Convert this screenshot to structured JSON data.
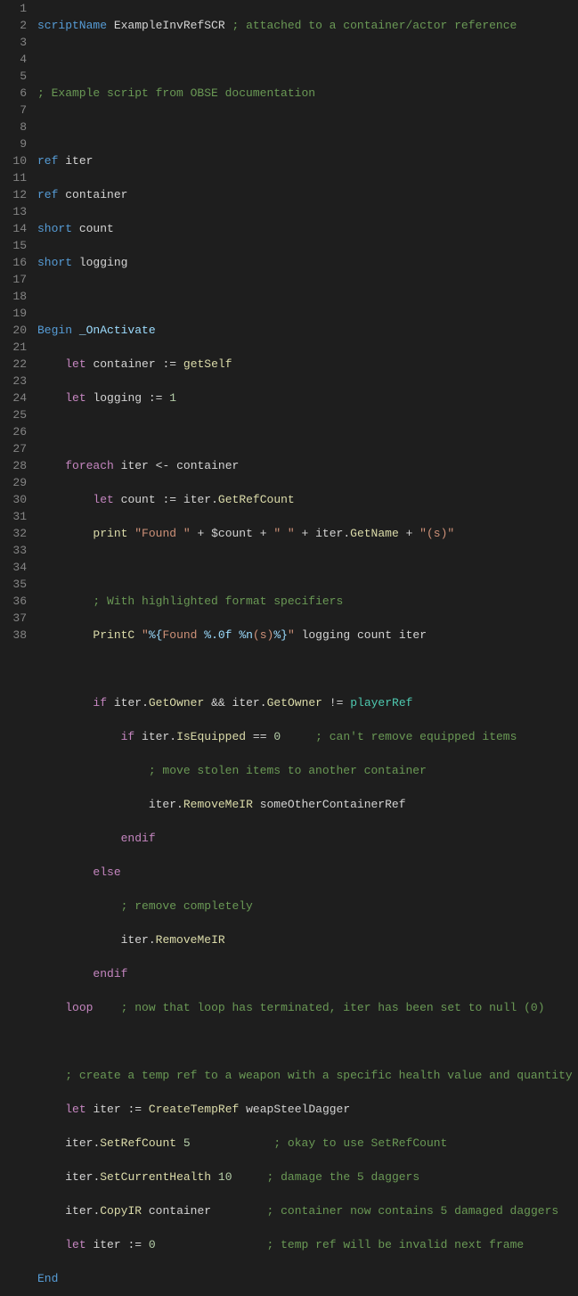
{
  "gutter": {
    "start": 1,
    "end": 38
  },
  "code": {
    "l1": {
      "kw": "scriptName",
      "name": "ExampleInvRefSCR",
      "com": "; attached to a container/actor reference"
    },
    "l3": {
      "com": "; Example script from OBSE documentation"
    },
    "l5": {
      "kw": "ref",
      "name": "iter"
    },
    "l6": {
      "kw": "ref",
      "name": "container"
    },
    "l7": {
      "kw": "short",
      "name": "count"
    },
    "l8": {
      "kw": "short",
      "name": "logging"
    },
    "l10": {
      "kw": "Begin",
      "name": "_OnActivate"
    },
    "l11": {
      "kw": "let",
      "name": "container",
      "op": ":=",
      "fn": "getSelf"
    },
    "l12": {
      "kw": "let",
      "name": "logging",
      "op": ":=",
      "num": "1"
    },
    "l14": {
      "kw": "foreach",
      "name": "iter",
      "op": "<-",
      "name2": "container"
    },
    "l15": {
      "kw": "let",
      "name": "count",
      "op": ":=",
      "id": "iter",
      "dot": ".",
      "fn": "GetRefCount"
    },
    "l16": {
      "fn": "print",
      "s1": "\"Found \"",
      "plus": " + ",
      "dol": "$",
      "id": "count",
      "s2": "\" \"",
      "id2": "iter",
      "dot": ".",
      "fn2": "GetName",
      "s3": "\"(s)\""
    },
    "l18": {
      "com": "; With highlighted format specifiers"
    },
    "l19": {
      "fn": "PrintC",
      "sopen": "\"",
      "f1": "%{",
      "t1": "Found ",
      "f2": "%.0f",
      "t2": " ",
      "f3": "%n",
      "t3": "(s)",
      "f4": "%}",
      "sclose": "\"",
      "a1": "logging",
      "a2": "count",
      "a3": "iter"
    },
    "l21": {
      "kw": "if",
      "id": "iter",
      "dot": ".",
      "fn": "GetOwner",
      "op": "&&",
      "id2": "iter",
      "dot2": ".",
      "fn2": "GetOwner",
      "op2": "!=",
      "pr": "playerRef"
    },
    "l22": {
      "kw": "if",
      "id": "iter",
      "dot": ".",
      "fn": "IsEquipped",
      "op": "==",
      "num": "0",
      "com": "; can't remove equipped items"
    },
    "l23": {
      "com": "; move stolen items to another container"
    },
    "l24": {
      "id": "iter",
      "dot": ".",
      "fn": "RemoveMeIR",
      "arg": "someOtherContainerRef"
    },
    "l25": {
      "kw": "endif"
    },
    "l26": {
      "kw": "else"
    },
    "l27": {
      "com": "; remove completely"
    },
    "l28": {
      "id": "iter",
      "dot": ".",
      "fn": "RemoveMeIR"
    },
    "l29": {
      "kw": "endif"
    },
    "l30": {
      "kw": "loop",
      "com": "; now that loop has terminated, iter has been set to null (0)"
    },
    "l32": {
      "com": "; create a temp ref to a weapon with a specific health value and quantity"
    },
    "l33": {
      "kw": "let",
      "name": "iter",
      "op": ":=",
      "fn": "CreateTempRef",
      "arg": "weapSteelDagger"
    },
    "l34": {
      "id": "iter",
      "dot": ".",
      "fn": "SetRefCount",
      "num": "5",
      "com": "; okay to use SetRefCount"
    },
    "l35": {
      "id": "iter",
      "dot": ".",
      "fn": "SetCurrentHealth",
      "num": "10",
      "com": "; damage the 5 daggers"
    },
    "l36": {
      "id": "iter",
      "dot": ".",
      "fn": "CopyIR",
      "arg": "container",
      "com": "; container now contains 5 damaged daggers"
    },
    "l37": {
      "kw": "let",
      "name": "iter",
      "op": ":=",
      "num": "0",
      "com": "; temp ref will be invalid next frame"
    },
    "l38": {
      "kw": "End"
    }
  }
}
